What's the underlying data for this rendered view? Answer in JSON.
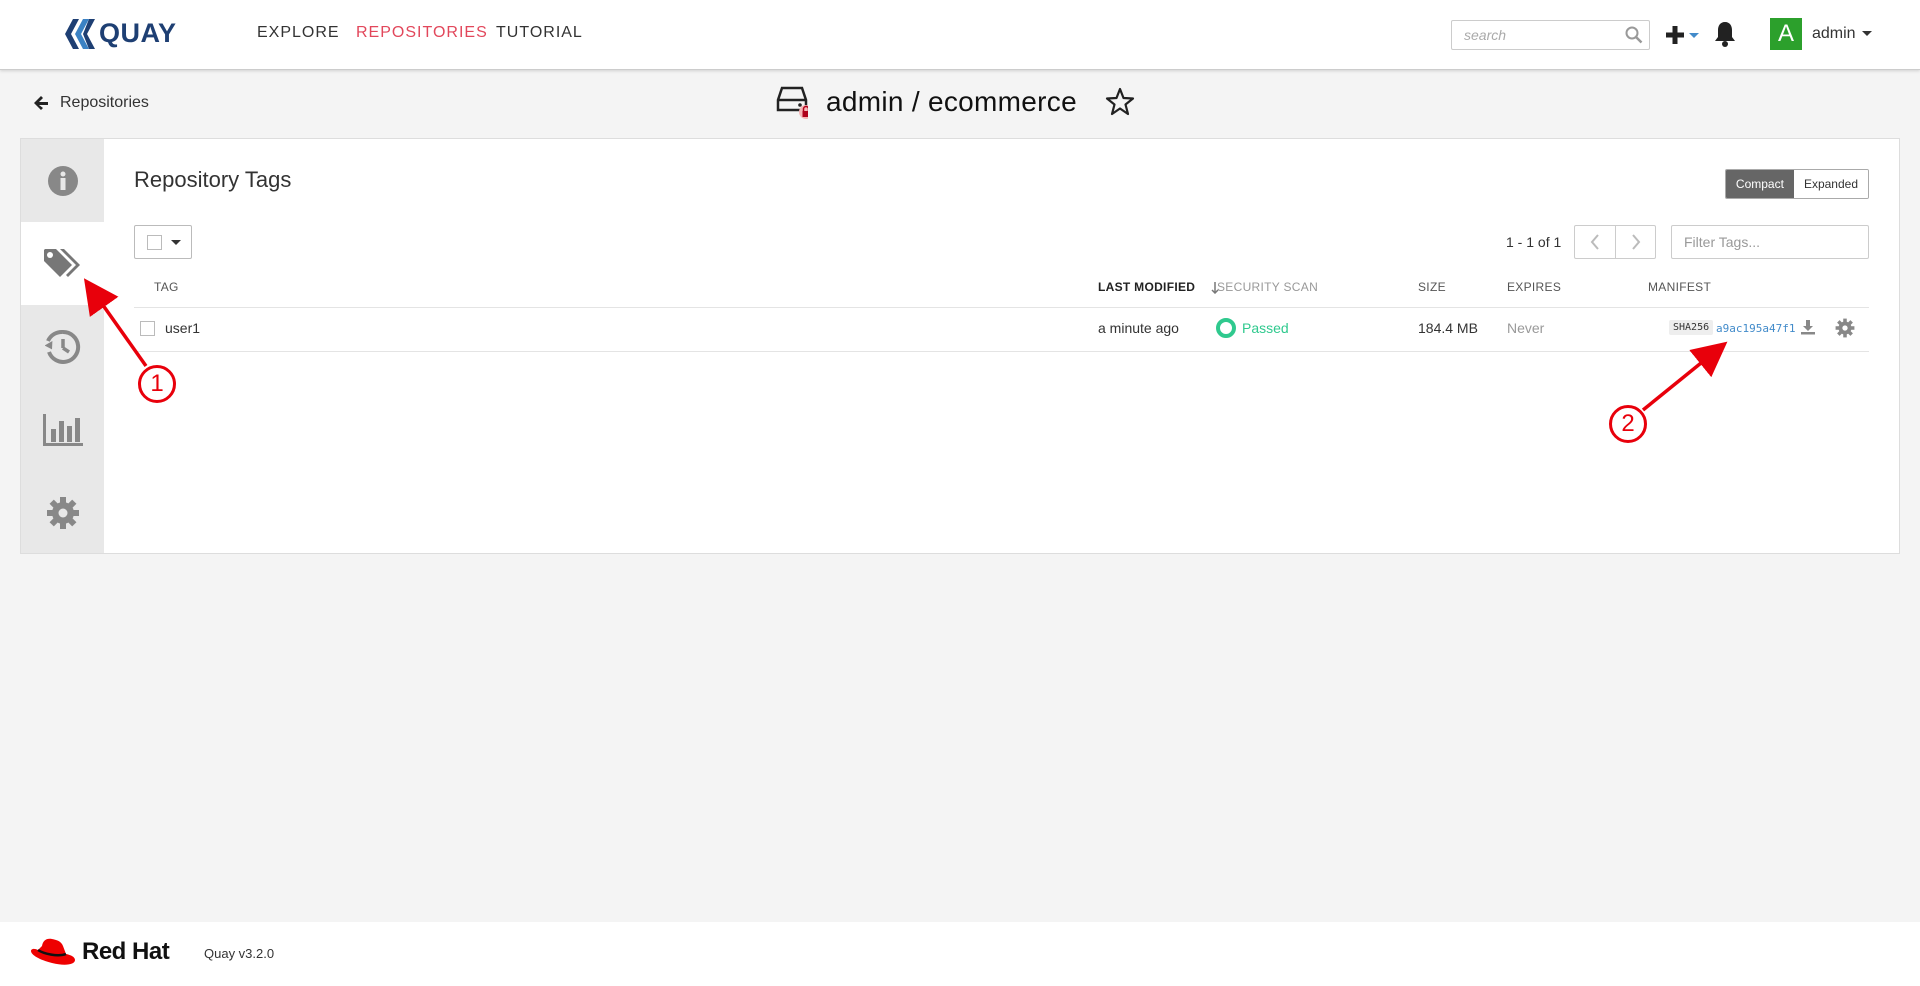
{
  "brand": {
    "name": "QUAY",
    "color": "#1e3f73"
  },
  "nav": {
    "links": [
      {
        "label": "EXPLORE",
        "active": false
      },
      {
        "label": "REPOSITORIES",
        "active": true
      },
      {
        "label": "TUTORIAL",
        "active": false
      }
    ],
    "search_placeholder": "search",
    "user": {
      "avatar_letter": "A",
      "name": "admin",
      "avatar_color": "#2ca02c"
    },
    "accent_color": "#e2475b"
  },
  "header": {
    "back_label": "Repositories",
    "repo_title": "admin / ecommerce"
  },
  "tags_page": {
    "heading": "Repository Tags",
    "view_modes": {
      "compact": "Compact",
      "expanded": "Expanded",
      "selected": "Compact"
    },
    "pager_text": "1 - 1 of 1",
    "filter_placeholder": "Filter Tags...",
    "columns": {
      "tag": "TAG",
      "last_modified": "LAST MODIFIED",
      "security_scan": "SECURITY SCAN",
      "size": "SIZE",
      "expires": "EXPIRES",
      "manifest": "MANIFEST"
    },
    "rows": [
      {
        "tag": "user1",
        "last_modified": "a minute ago",
        "security_scan": "Passed",
        "size": "184.4 MB",
        "expires": "Never",
        "manifest_algo": "SHA256",
        "manifest_digest": "a9ac195a47f1"
      }
    ]
  },
  "side_tabs": [
    {
      "icon": "info-icon",
      "active": false
    },
    {
      "icon": "tags-icon",
      "active": true
    },
    {
      "icon": "history-icon",
      "active": false
    },
    {
      "icon": "usage-chart-icon",
      "active": false
    },
    {
      "icon": "settings-icon",
      "active": false
    }
  ],
  "annotations": [
    "1",
    "2"
  ],
  "footer": {
    "company": "Red Hat",
    "version": "Quay v3.2.0"
  }
}
